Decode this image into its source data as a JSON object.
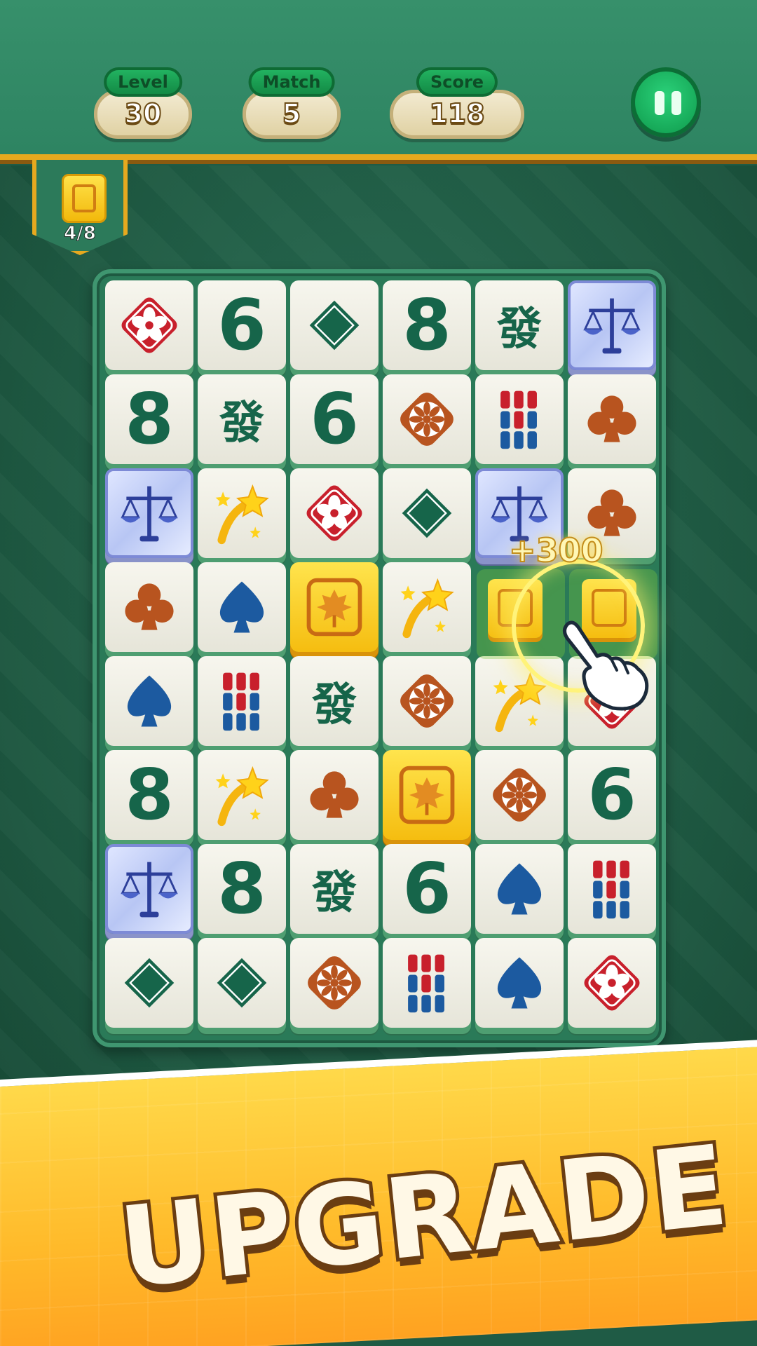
{
  "hud": {
    "level": {
      "label": "Level",
      "value": "30"
    },
    "match": {
      "label": "Match",
      "value": "5"
    },
    "score": {
      "label": "Score",
      "value": "118"
    }
  },
  "goal": {
    "progress": "4/8",
    "icon": "gold-flower-tile-icon"
  },
  "board": {
    "rows": 8,
    "cols": 6,
    "tiles": [
      [
        "flower-red",
        "6",
        "diamond",
        "8",
        "發",
        "scales-crystal"
      ],
      [
        "8",
        "發",
        "6",
        "flower-orange",
        "bamboo",
        "club"
      ],
      [
        "scales-crystal",
        "shooting-star",
        "flower-red",
        "diamond",
        "scales-crystal",
        "club"
      ],
      [
        "club",
        "spade",
        "gold-leaf",
        "shooting-star",
        "empty",
        "empty"
      ],
      [
        "spade",
        "bamboo",
        "發",
        "flower-orange",
        "shooting-star",
        "flower-red"
      ],
      [
        "8",
        "shooting-star",
        "club",
        "gold-leaf",
        "flower-orange",
        "6"
      ],
      [
        "scales-crystal",
        "8",
        "發",
        "6",
        "spade",
        "bamboo"
      ],
      [
        "diamond",
        "diamond",
        "flower-orange",
        "bamboo",
        "spade",
        "flower-red"
      ]
    ]
  },
  "effect": {
    "bonus": "+300"
  },
  "banner": {
    "title": "UPGRADE"
  },
  "colors": {
    "felt": "#2a7a58",
    "tile_green": "#16654a",
    "accent_gold": "#e6a91f",
    "banner": "#ffba2a"
  }
}
